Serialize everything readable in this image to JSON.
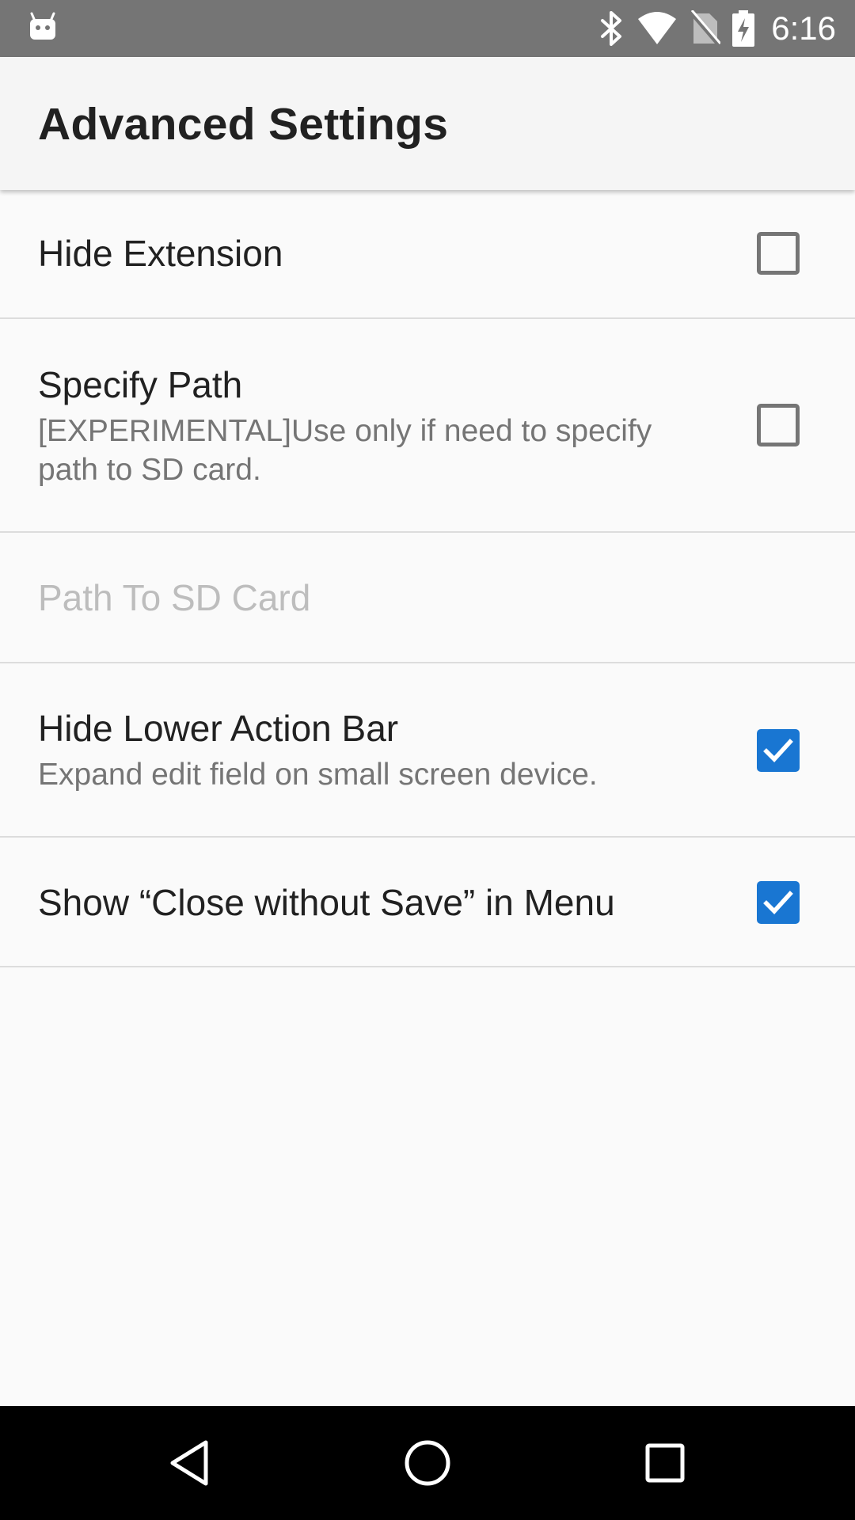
{
  "status_bar": {
    "time": "6:16",
    "icons": [
      "android-debug-icon",
      "bluetooth-icon",
      "wifi-icon",
      "no-sim-icon",
      "battery-charging-icon"
    ]
  },
  "app_bar": {
    "title": "Advanced Settings"
  },
  "preferences": {
    "hide_extension": {
      "title": "Hide Extension",
      "checked": false
    },
    "specify_path": {
      "title": "Specify Path",
      "summary": "[EXPERIMENTAL]Use only if need to specify path to SD card.",
      "checked": false
    },
    "path_to_sd_card": {
      "placeholder": "Path To SD Card"
    },
    "hide_lower_action_bar": {
      "title": "Hide Lower Action Bar",
      "summary": "Expand edit field on small screen device.",
      "checked": true
    },
    "show_close_without_save": {
      "title": "Show “Close without Save” in Menu",
      "checked": true
    }
  },
  "nav_bar": {
    "buttons": [
      "back-icon",
      "home-icon",
      "recents-icon"
    ]
  },
  "colors": {
    "status_bar": "#757575",
    "app_bar": "#f5f5f5",
    "accent": "#1976d2",
    "nav_bar": "#000000"
  }
}
